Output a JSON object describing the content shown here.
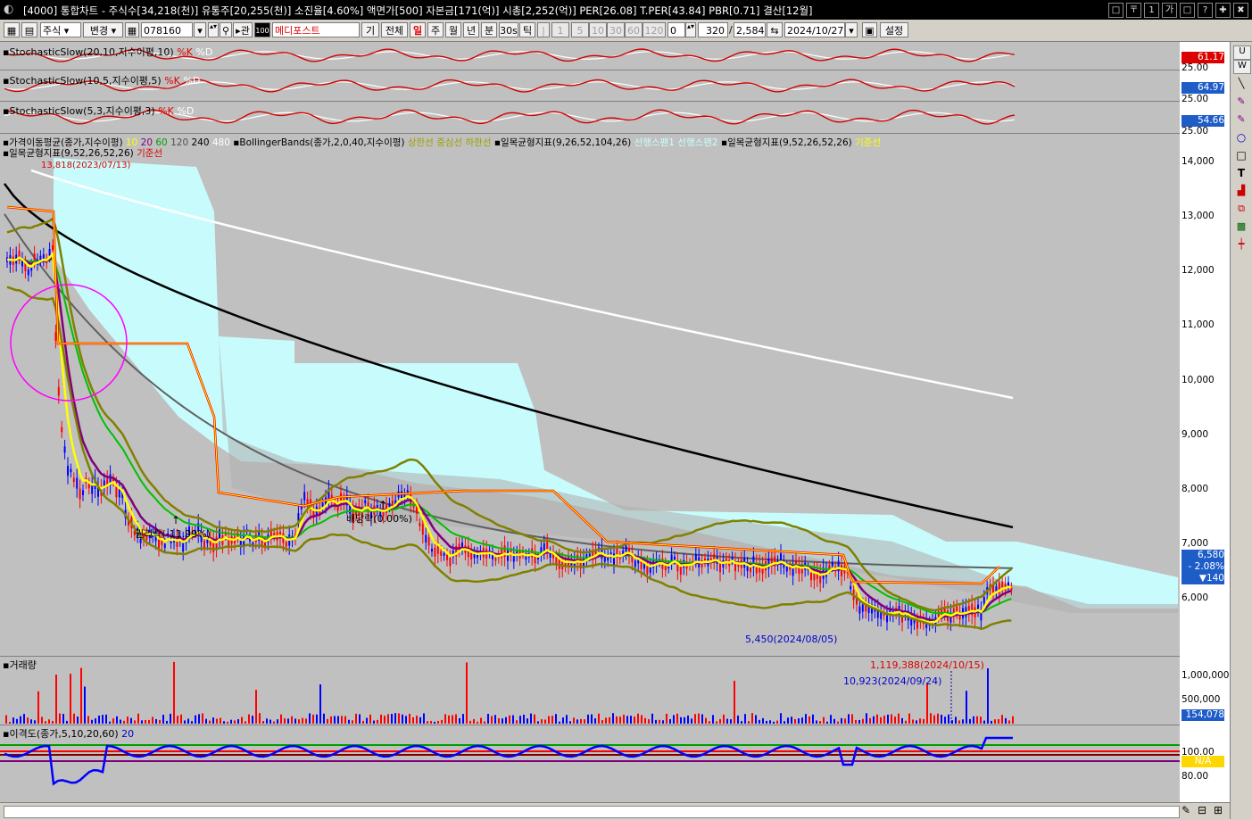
{
  "window": {
    "title": "[4000] 통합차트 - 주식수[34,218(천)] 유통주[20,255(천)] 소진율[4.60%] 액면가[500] 자본금[171(억)] 시총[2,252(억)] PER[26.08] T.PER[43.84] PBR[0.71] 결산[12월]",
    "buttons": [
      "□",
      "〒",
      "1",
      "가",
      "□",
      "?",
      "✚",
      "✖"
    ]
  },
  "toolbar": {
    "market": "주식",
    "change": "변경",
    "code": "078160",
    "name": "메디포스트",
    "period_buttons": [
      "기",
      "전체",
      "일",
      "주",
      "월",
      "년",
      "분",
      "30s",
      "틱"
    ],
    "interval_buttons": [
      "1",
      "5",
      "10",
      "30",
      "60",
      "120"
    ],
    "spin_value": "0",
    "count_value": "320",
    "total_count": "2,584",
    "date": "2024/10/27",
    "settings": "설정"
  },
  "panels": {
    "stoch1": {
      "label": "StochasticSlow(20,10,지수이평,10)",
      "k": "%K",
      "d": "%D",
      "value": "61.17",
      "axis": "25.00"
    },
    "stoch2": {
      "label": "StochasticSlow(10,5,지수이평,5)",
      "k": "%K",
      "d": "%D",
      "value": "64.97",
      "axis": "25.00"
    },
    "stoch3": {
      "label": "StochasticSlow(5,3,지수이평,3)",
      "k": "%K",
      "d": "%D",
      "value": "54.66",
      "axis": "25.00"
    },
    "price": {
      "ma_label": "가격이동평균(종가,지수이평)",
      "ma_periods": [
        "10",
        "20",
        "60",
        "120",
        "240",
        "480"
      ],
      "bb_label": "BollingerBands(종가,2,0,40,지수이평)",
      "bb_lines": [
        "상한선",
        "중심선",
        "하한선"
      ],
      "ichimoku1_label": "일목균형지표(9,26,52,104,26)",
      "ichimoku1_lines": [
        "선행스팬1",
        "선행스팬2"
      ],
      "ichimoku2_label": "일목균형지표(9,52,26,52,26)",
      "ichimoku2_line": "기준선",
      "ichimoku3_label": "일목균형지표(9,52,26,52,26)",
      "ichimoku3_line": "기준선",
      "axis_ticks": [
        "14,000",
        "13,000",
        "12,000",
        "11,000",
        "10,000",
        "9,000",
        "8,000",
        "7,000",
        "6,000"
      ],
      "high_note": "13,818(2023/07/13)",
      "low_note": "5,450(2024/08/05)",
      "event1": "권리락(-11.99%)",
      "event2": "배당락(0.00%)",
      "current_price": "6,580",
      "change_pct": "- 2.08%",
      "change_amt": "▼140"
    },
    "volume": {
      "label": "거래량",
      "axis_ticks": [
        "1,000,000",
        "500,000"
      ],
      "peak_note": "1,119,388(2024/10/15)",
      "low_note": "10,923(2024/09/24)",
      "current": "154,078"
    },
    "disparity": {
      "label": "이격도(종가,5,10,20,60)",
      "period": "20",
      "axis_ticks": [
        "100.00",
        "80.00"
      ],
      "current": "N/A"
    }
  },
  "colors": {
    "background": "#c0c0c0",
    "cloud": "#c8ffff",
    "ma10": "#ffff00",
    "ma20": "#800080",
    "ma60": "#00c000",
    "ma120": "#606060",
    "ma240": "#000000",
    "ma480": "#ffffff",
    "bollinger": "#808000",
    "kijun": "#ff0000",
    "up": "#ff0000",
    "down": "#0000ff"
  }
}
